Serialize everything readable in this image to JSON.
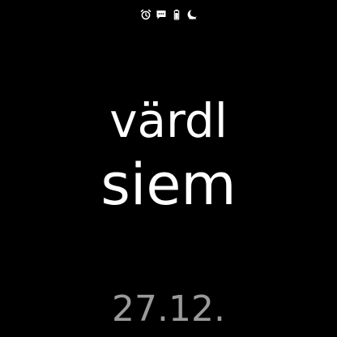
{
  "status_bar": {
    "icons": [
      "alarm-icon",
      "message-icon",
      "battery-icon",
      "do-not-disturb-icon"
    ]
  },
  "clock": {
    "time_line_1": "värdl",
    "time_line_2": "siem"
  },
  "date": {
    "text": "27.12."
  },
  "colors": {
    "background": "#000000",
    "time_text": "#ffffff",
    "date_text": "#9a9a9a",
    "status_icons": "#ffffff"
  }
}
